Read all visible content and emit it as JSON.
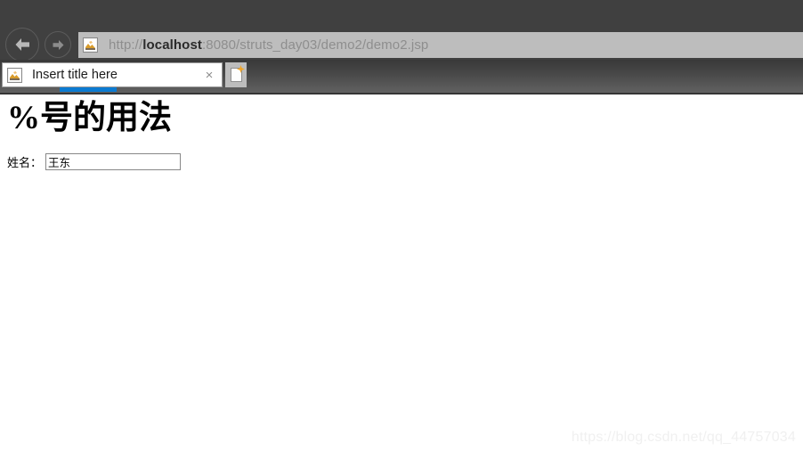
{
  "browser": {
    "nav": {
      "back_label": "Back",
      "back_icon": "arrow-left-icon",
      "forward_label": "Forward",
      "forward_icon": "arrow-right-icon"
    },
    "address_bar": {
      "favicon": "broken-image-icon",
      "url_prefix": "http://",
      "url_host": "localhost",
      "url_suffix": ":8080/struts_day03/demo2/demo2.jsp",
      "full_url": "http://localhost:8080/struts_day03/demo2/demo2.jsp"
    },
    "tabs": [
      {
        "favicon": "broken-image-icon",
        "title": "Insert title here",
        "close_label": "×",
        "active": true
      }
    ],
    "new_tab": {
      "label": "New tab",
      "icon": "new-page-icon"
    },
    "accent_color": "#0b7ad1",
    "chrome_color": "#404040",
    "address_bar_color": "#bdbdbd"
  },
  "page": {
    "heading": "%号的用法",
    "form": {
      "name_label": "姓名：",
      "name_value": "王东",
      "name_placeholder": ""
    },
    "watermark": "https://blog.csdn.net/qq_44757034"
  }
}
